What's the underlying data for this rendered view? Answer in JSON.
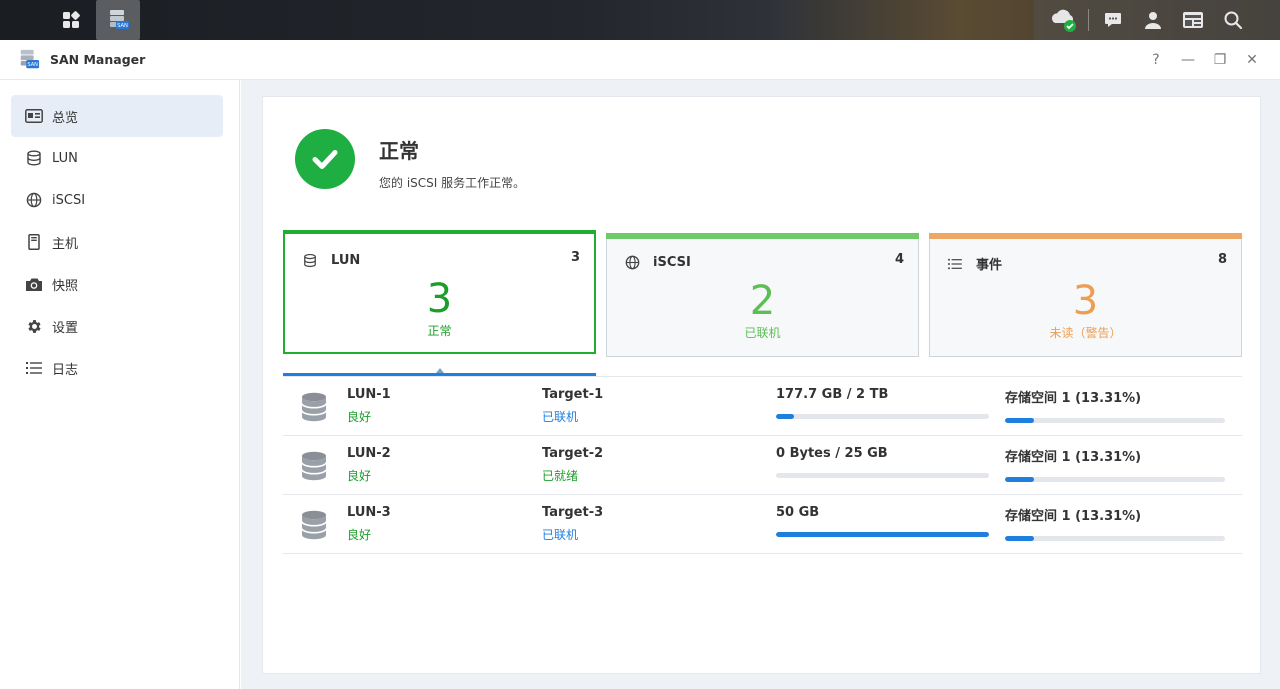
{
  "app": {
    "title": "SAN Manager"
  },
  "window_controls": {
    "help": "?",
    "minimize": "—",
    "restore": "❐",
    "close": "✕"
  },
  "taskbar": {
    "left": [
      "apps-grid-icon",
      "san-manager-icon"
    ],
    "right": [
      "cloud-status-icon",
      "chat-icon",
      "user-icon",
      "widgets-icon",
      "search-icon"
    ]
  },
  "sidebar": {
    "items": [
      {
        "label": "总览",
        "icon": "overview-icon",
        "active": true
      },
      {
        "label": "LUN",
        "icon": "database-icon"
      },
      {
        "label": "iSCSI",
        "icon": "globe-icon"
      },
      {
        "label": "主机",
        "icon": "host-icon"
      },
      {
        "label": "快照",
        "icon": "camera-icon"
      },
      {
        "label": "设置",
        "icon": "gear-icon"
      },
      {
        "label": "日志",
        "icon": "list-icon"
      }
    ]
  },
  "status": {
    "title": "正常",
    "description": "您的 iSCSI 服务工作正常。"
  },
  "cards": {
    "lun": {
      "label": "LUN",
      "count": "3",
      "value": "3",
      "sub": "正常"
    },
    "iscsi": {
      "label": "iSCSI",
      "count": "4",
      "value": "2",
      "sub": "已联机"
    },
    "events": {
      "label": "事件",
      "count": "8",
      "value": "3",
      "sub": "未读（警告）"
    }
  },
  "colors": {
    "accent": "#1f7fdd",
    "ok": "#1fae2d",
    "iscsi": "#6fca6a",
    "warn": "#eea863"
  },
  "lun_rows": [
    {
      "name": "LUN-1",
      "status": "良好",
      "target": "Target-1",
      "target_status": "已联机",
      "size": "177.7 GB / 2 TB",
      "size_fill": 0.0868,
      "pool": "存储空间 1 (13.31%)",
      "pool_fill": 0.1331
    },
    {
      "name": "LUN-2",
      "status": "良好",
      "target": "Target-2",
      "target_status": "已就绪",
      "size": "0 Bytes / 25 GB",
      "size_fill": 0,
      "pool": "存储空间 1 (13.31%)",
      "pool_fill": 0.1331
    },
    {
      "name": "LUN-3",
      "status": "良好",
      "target": "Target-3",
      "target_status": "已联机",
      "size": "50 GB",
      "size_fill": 1.0,
      "pool": "存储空间 1 (13.31%)",
      "pool_fill": 0.1331
    }
  ]
}
